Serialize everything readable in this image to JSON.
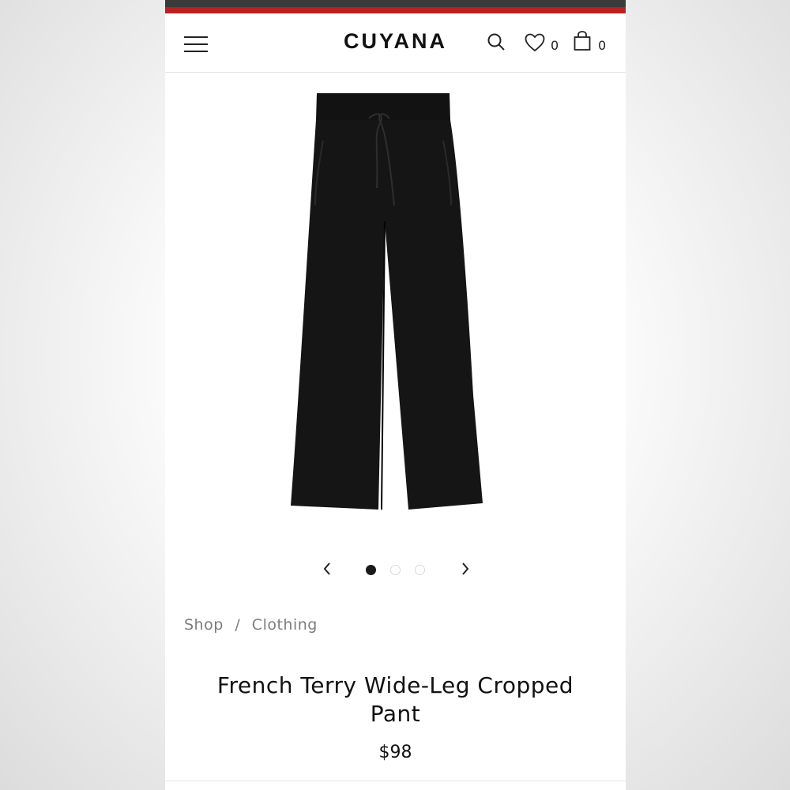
{
  "header": {
    "brand": "CUYANA",
    "wishlist_count": "0",
    "cart_count": "0",
    "icons": [
      "menu-icon",
      "search-icon",
      "heart-icon",
      "bag-icon"
    ]
  },
  "colors": {
    "top_stripe_dark": "#3a3a3a",
    "top_stripe_red": "#b8211f",
    "product": "#111111"
  },
  "carousel": {
    "total_slides": 3,
    "active_slide": 1
  },
  "breadcrumb": {
    "items": [
      "Shop",
      "Clothing"
    ],
    "separator": "/"
  },
  "product": {
    "name_line1": "French Terry Wide-Leg Cropped",
    "name_line2": "Pant",
    "price": "$98"
  }
}
